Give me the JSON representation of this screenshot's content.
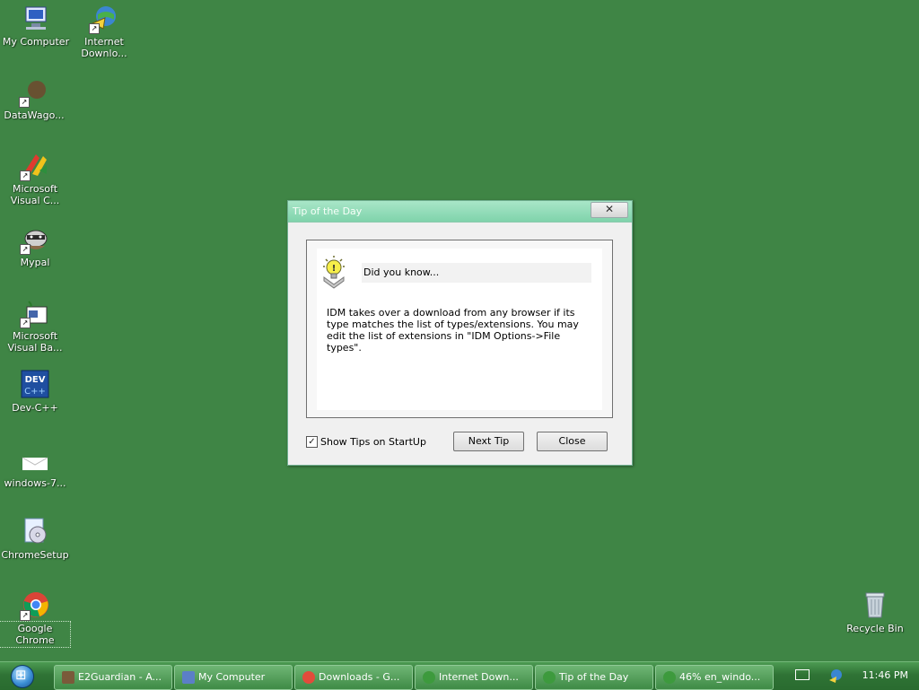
{
  "desktop": {
    "icons": [
      {
        "label": "My Computer"
      },
      {
        "label": "Internet Downlo..."
      },
      {
        "label": "DataWago..."
      },
      {
        "label": "Microsoft Visual C..."
      },
      {
        "label": "Mypal"
      },
      {
        "label": "Microsoft Visual Ba..."
      },
      {
        "label": "Dev-C++"
      },
      {
        "label": "windows-7..."
      },
      {
        "label": "ChromeSetup"
      },
      {
        "label": "Google Chrome"
      },
      {
        "label": "Recycle Bin"
      }
    ]
  },
  "dialog": {
    "title": "Tip of the Day",
    "close_glyph": "✕",
    "heading": "Did you know...",
    "tip": "IDM takes over a download from any browser if its type matches the list of types/extensions. You may edit the list of extensions in \"IDM Options->File types\".",
    "show_tips_label": "Show Tips on StartUp",
    "show_tips_checked": true,
    "next_button": "Next Tip",
    "close_button": "Close"
  },
  "taskbar": {
    "items": [
      {
        "label": "E2Guardian - A...",
        "icon": "raccoon-icon",
        "color": "#7a5a3a"
      },
      {
        "label": "My Computer",
        "icon": "computer-icon",
        "color": "#5b7fc7"
      },
      {
        "label": "Downloads - G...",
        "icon": "chrome-icon",
        "color": "#e34b3b"
      },
      {
        "label": "Internet Down...",
        "icon": "idm-icon",
        "color": "#3d9a3d"
      },
      {
        "label": "Tip of the Day",
        "icon": "idm-icon",
        "color": "#3d9a3d"
      },
      {
        "label": "46% en_windo...",
        "icon": "idm-icon",
        "color": "#3d9a3d"
      }
    ],
    "clock": "11:46 PM"
  }
}
